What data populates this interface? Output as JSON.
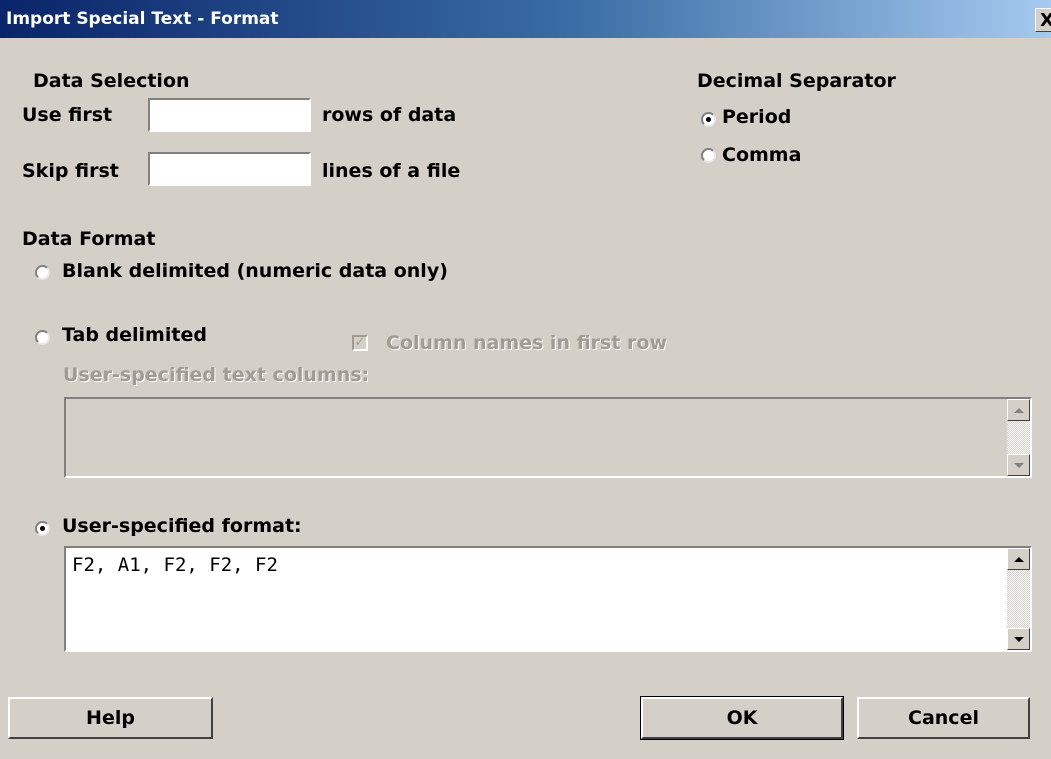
{
  "window": {
    "title": "Import Special Text - Format",
    "close_label": "X"
  },
  "data_selection": {
    "heading": "Data Selection",
    "use_first_label": "Use first",
    "use_first_value": "",
    "rows_suffix": "rows of data",
    "skip_first_label": "Skip first",
    "skip_first_value": "",
    "lines_suffix": "lines of a file"
  },
  "decimal_separator": {
    "heading": "Decimal Separator",
    "options": [
      {
        "label": "Period",
        "selected": true
      },
      {
        "label": "Comma",
        "selected": false
      }
    ]
  },
  "data_format": {
    "heading": "Data Format",
    "blank_label": "Blank delimited (numeric data only)",
    "tab_label": "Tab delimited",
    "column_names_label": "Column names in first row",
    "column_names_checked": true,
    "text_columns_label": "User-specified text columns:",
    "text_columns_value": "",
    "user_format_label": "User-specified format:",
    "user_format_value": "F2, A1, F2, F2, F2",
    "selected": "user-specified"
  },
  "buttons": {
    "help": "Help",
    "ok": "OK",
    "cancel": "Cancel"
  }
}
